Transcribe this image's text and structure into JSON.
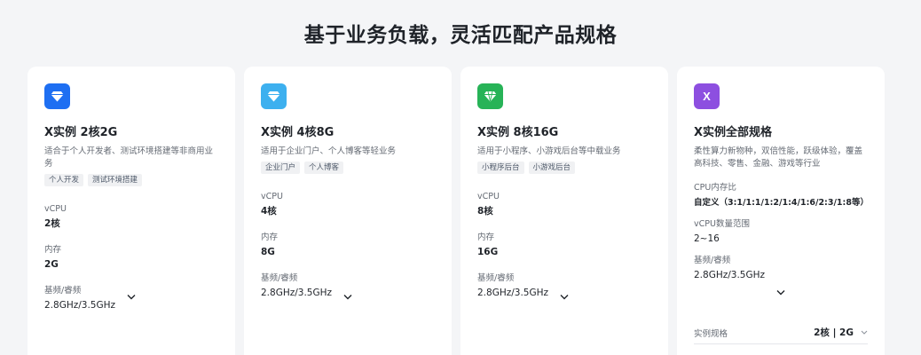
{
  "header": {
    "title": "基于业务负载，灵活匹配产品规格"
  },
  "cards": [
    {
      "title": "X实例 2核2G",
      "desc": "适合于个人开发者、测试环境搭建等非商用业务",
      "tags": [
        "个人开发",
        "测试环境搭建"
      ],
      "specs": [
        {
          "label": "vCPU",
          "value": "2核"
        },
        {
          "label": "内存",
          "value": "2G"
        },
        {
          "label": "基频/睿频",
          "value": "2.8GHz/3.5GHz"
        }
      ],
      "icon": "diamond-icon",
      "color": "#1e6ff2"
    },
    {
      "title": "X实例 4核8G",
      "desc": "适用于企业门户、个人博客等轻业务",
      "tags": [
        "企业门户",
        "个人博客"
      ],
      "specs": [
        {
          "label": "vCPU",
          "value": "4核"
        },
        {
          "label": "内存",
          "value": "8G"
        },
        {
          "label": "基频/睿频",
          "value": "2.8GHz/3.5GHz"
        }
      ],
      "icon": "diamond-icon",
      "color": "#3db0ef"
    },
    {
      "title": "X实例 8核16G",
      "desc": "适用于小程序、小游戏后台等中载业务",
      "tags": [
        "小程序后台",
        "小游戏后台"
      ],
      "specs": [
        {
          "label": "vCPU",
          "value": "8核"
        },
        {
          "label": "内存",
          "value": "16G"
        },
        {
          "label": "基频/睿频",
          "value": "2.8GHz/3.5GHz"
        }
      ],
      "icon": "gem-icon",
      "color": "#27b357"
    },
    {
      "title": "X实例全部规格",
      "icon_text": "X",
      "desc": "柔性算力新物种，双倍性能，跃级体验，覆盖高科技、零售、金融、游戏等行业",
      "specs": [
        {
          "label": "CPU内存比",
          "value": "自定义（3:1/1:1/1:2/1:4/1:6/2:3/1:8等）"
        },
        {
          "label": "vCPU数量范围",
          "value": "2~16"
        },
        {
          "label": "基频/睿频",
          "value": "2.8GHz/3.5GHz"
        }
      ],
      "select": {
        "label": "实例规格",
        "value": "2核 | 2G"
      },
      "icon": "x-icon",
      "color": "#8d4fe0"
    }
  ]
}
